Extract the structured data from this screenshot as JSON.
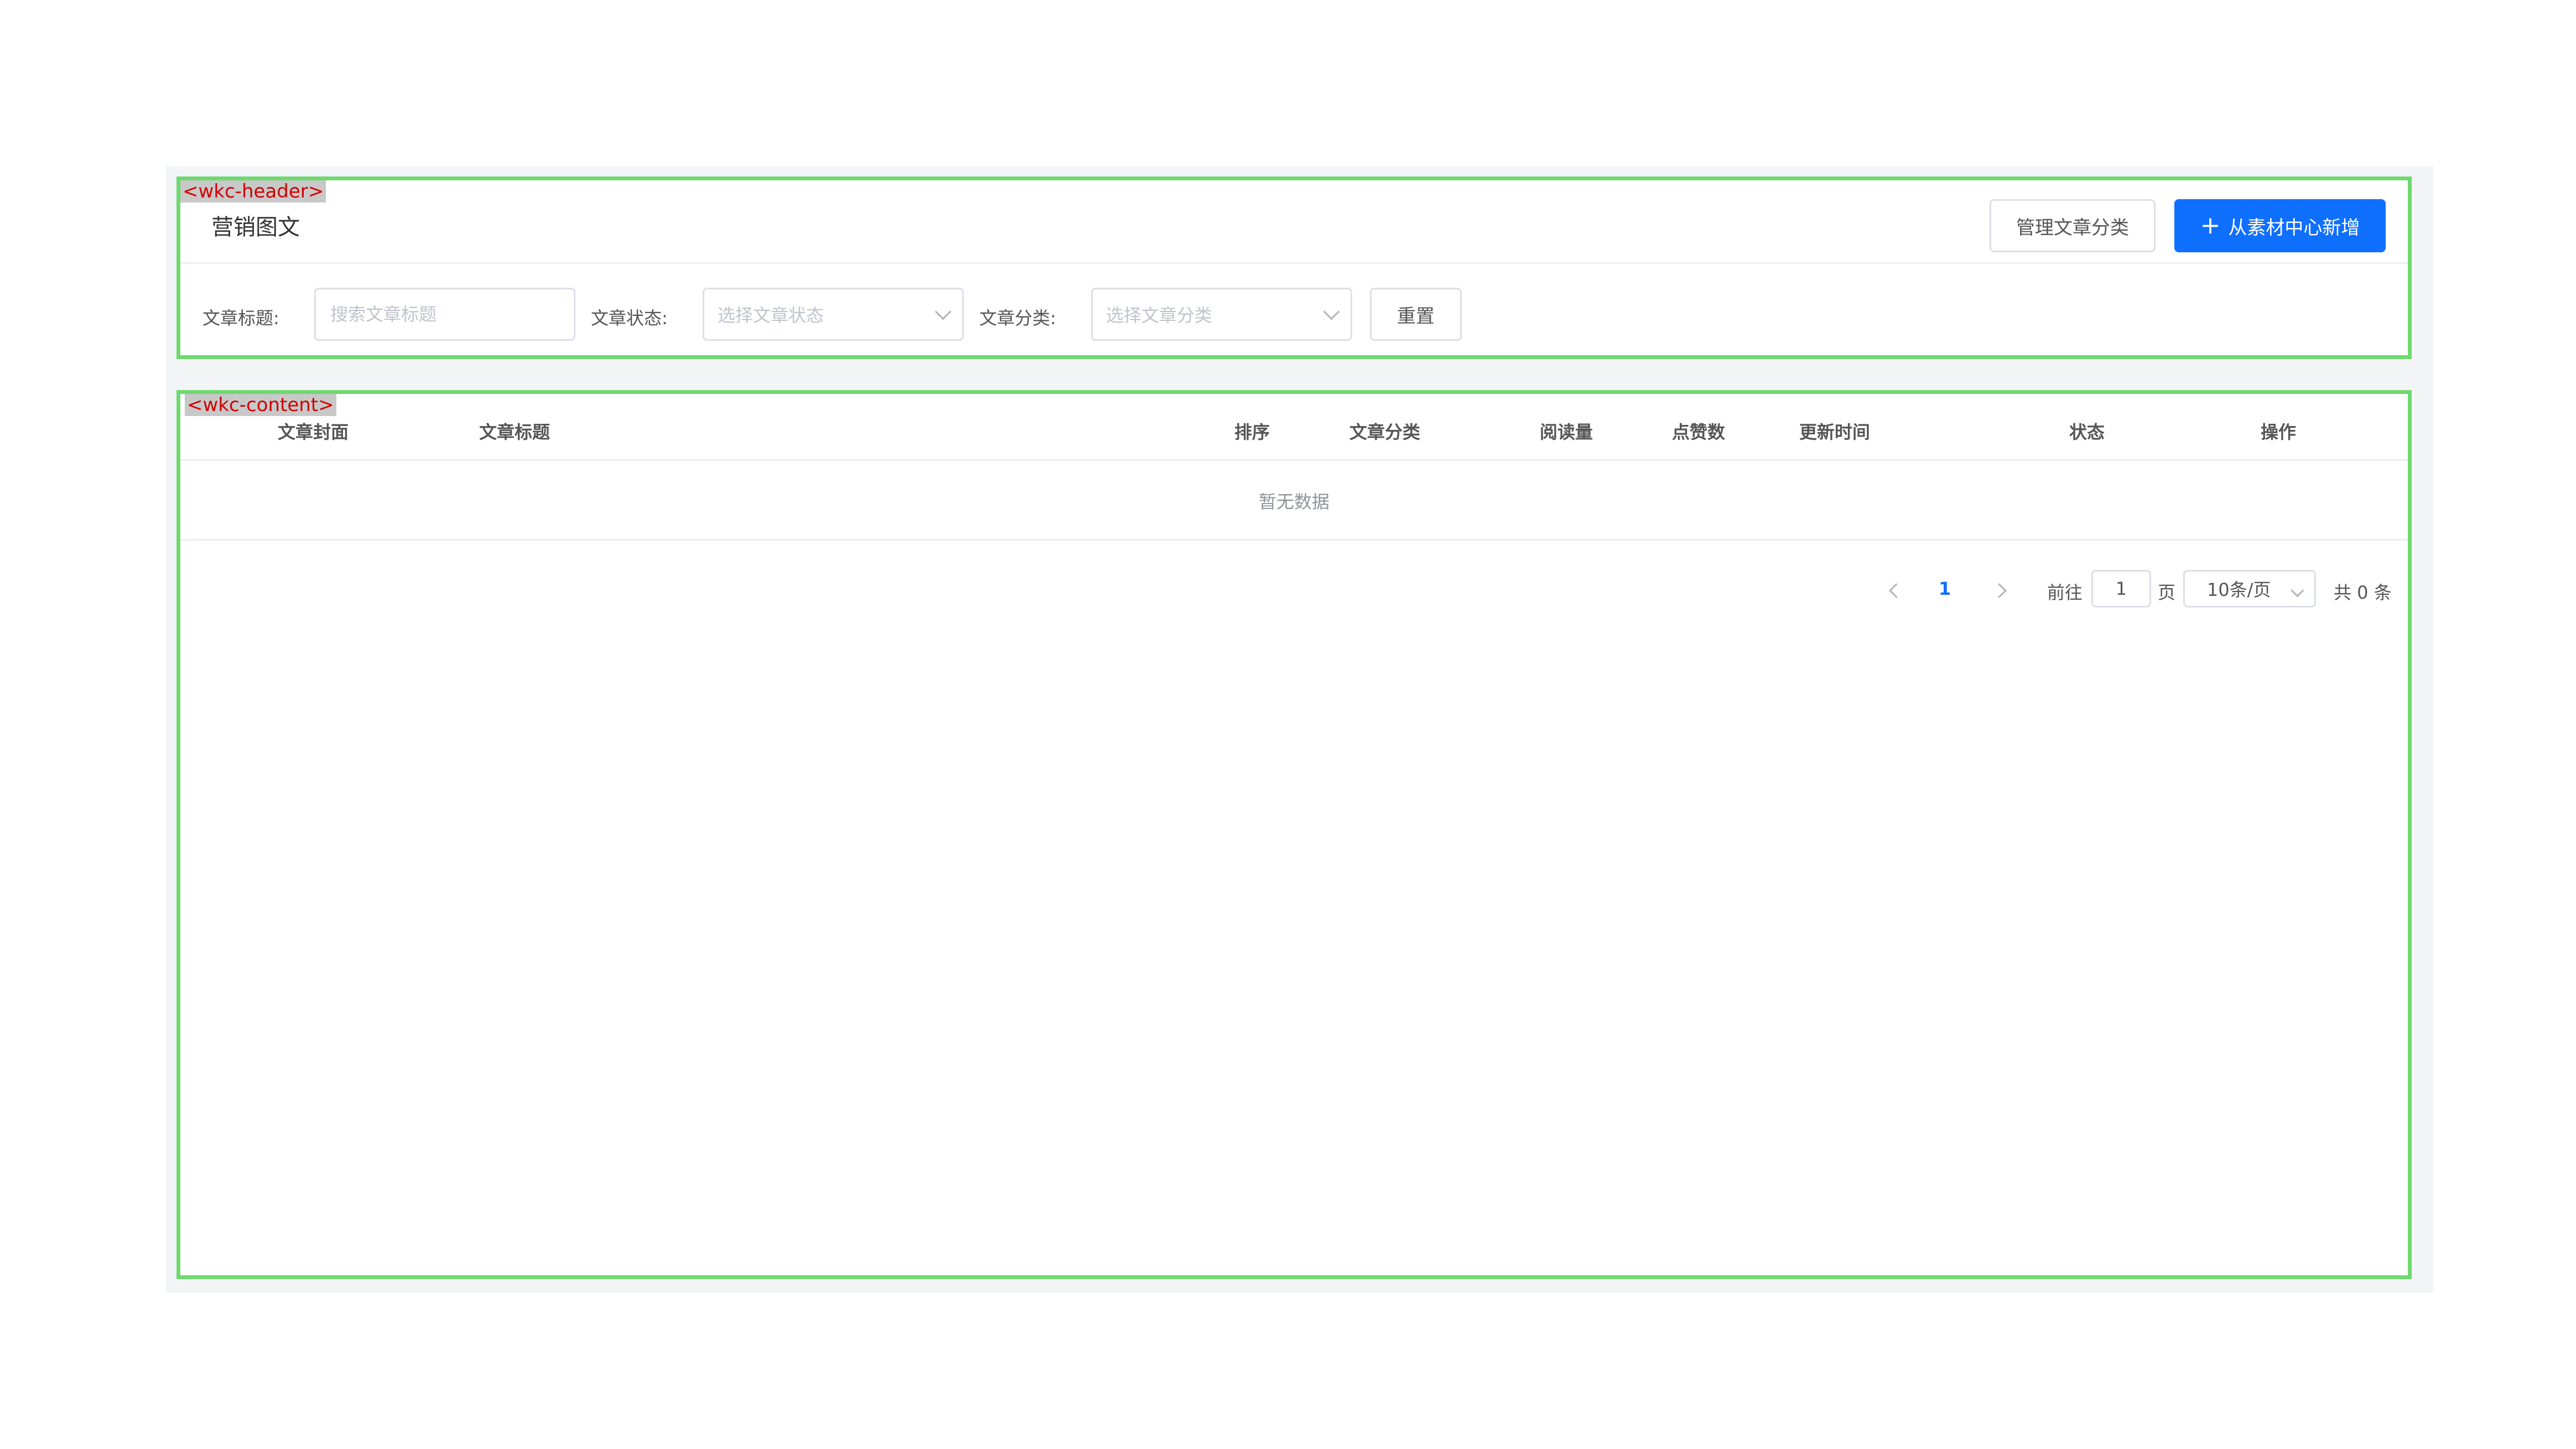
{
  "annotations": {
    "header_tag": "<wkc-header>",
    "content_tag": "<wkc-content>"
  },
  "header": {
    "title": "营销图文",
    "manage_category_label": "管理文章分类",
    "add_from_library_label": "从素材中心新增",
    "add_icon": "+"
  },
  "filters": {
    "title_label": "文章标题:",
    "title_placeholder": "搜索文章标题",
    "status_label": "文章状态:",
    "status_placeholder": "选择文章状态",
    "category_label": "文章分类:",
    "category_placeholder": "选择文章分类",
    "reset_label": "重置"
  },
  "table": {
    "columns": [
      "文章封面",
      "文章标题",
      "排序",
      "文章分类",
      "阅读量",
      "点赞数",
      "更新时间",
      "状态",
      "操作"
    ],
    "empty_text": "暂无数据"
  },
  "pagination": {
    "current_page": "1",
    "goto_prefix": "前往",
    "goto_value": "1",
    "goto_suffix": "页",
    "page_size": "10条/页",
    "total": "共 0 条"
  },
  "colors": {
    "primary": "#0f6fff",
    "annotation_border": "#6fd86f",
    "annotation_text": "#d00000"
  }
}
